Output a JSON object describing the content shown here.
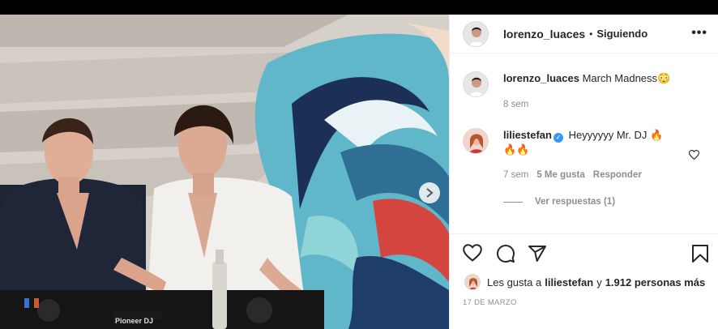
{
  "post": {
    "username": "lorenzo_luaces",
    "separator": "•",
    "follow_status": "Siguiendo",
    "more_label": "•••",
    "media": {
      "brand_text": "Pioneer DJ",
      "dots": 2,
      "active_dot": 0
    }
  },
  "comments": [
    {
      "username": "lorenzo_luaces",
      "text": "March Madness",
      "emoji": "😳",
      "time": "8 sem"
    },
    {
      "username": "liliestefan",
      "verified": true,
      "text": "Heyyyyyy Mr. DJ",
      "emoji": "🔥",
      "emoji_line2": "🔥🔥",
      "time": "7 sem",
      "likes": "5 Me gusta",
      "reply_label": "Responder",
      "view_replies": "Ver respuestas (1)"
    }
  ],
  "likes": {
    "prefix": "Les gusta a",
    "user": "liliestefan",
    "connector": "y",
    "count": "1.912 personas más"
  },
  "date": "17 DE MARZO",
  "colors": {
    "verified": "#3897f0",
    "active_dot": "#0095f6",
    "muted": "#8e8e8e"
  }
}
